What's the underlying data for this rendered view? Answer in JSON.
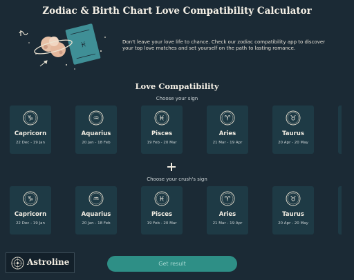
{
  "title": "Zodiac & Birth Chart Love Compatibility Calculator",
  "intro": "Don't leave your love life to chance. Check our zodiac compatibility app to discover your top love matches and set yourself on the path to lasting romance.",
  "section_title": "Love Compatibility",
  "your_sign_label": "Choose your sign",
  "crush_sign_label": "Choose your crush's sign",
  "signs": [
    {
      "name": "Capricorn",
      "dates": "22 Dec - 19 Jan",
      "icon": "capricorn-icon",
      "glyph": "♑"
    },
    {
      "name": "Aquarius",
      "dates": "20 Jan - 18 Feb",
      "icon": "aquarius-icon",
      "glyph": "♒"
    },
    {
      "name": "Pisces",
      "dates": "19 Feb - 20 Mar",
      "icon": "pisces-icon",
      "glyph": "♓"
    },
    {
      "name": "Aries",
      "dates": "21 Mar - 19 Apr",
      "icon": "aries-icon",
      "glyph": "♈"
    },
    {
      "name": "Taurus",
      "dates": "20 Apr - 20 May",
      "icon": "taurus-icon",
      "glyph": "♉"
    }
  ],
  "get_result_label": "Get result",
  "brand": "Astroline",
  "colors": {
    "background": "#1b2a35",
    "card": "#1e3a45",
    "button": "#2e8f86",
    "text": "#f1ece1"
  }
}
